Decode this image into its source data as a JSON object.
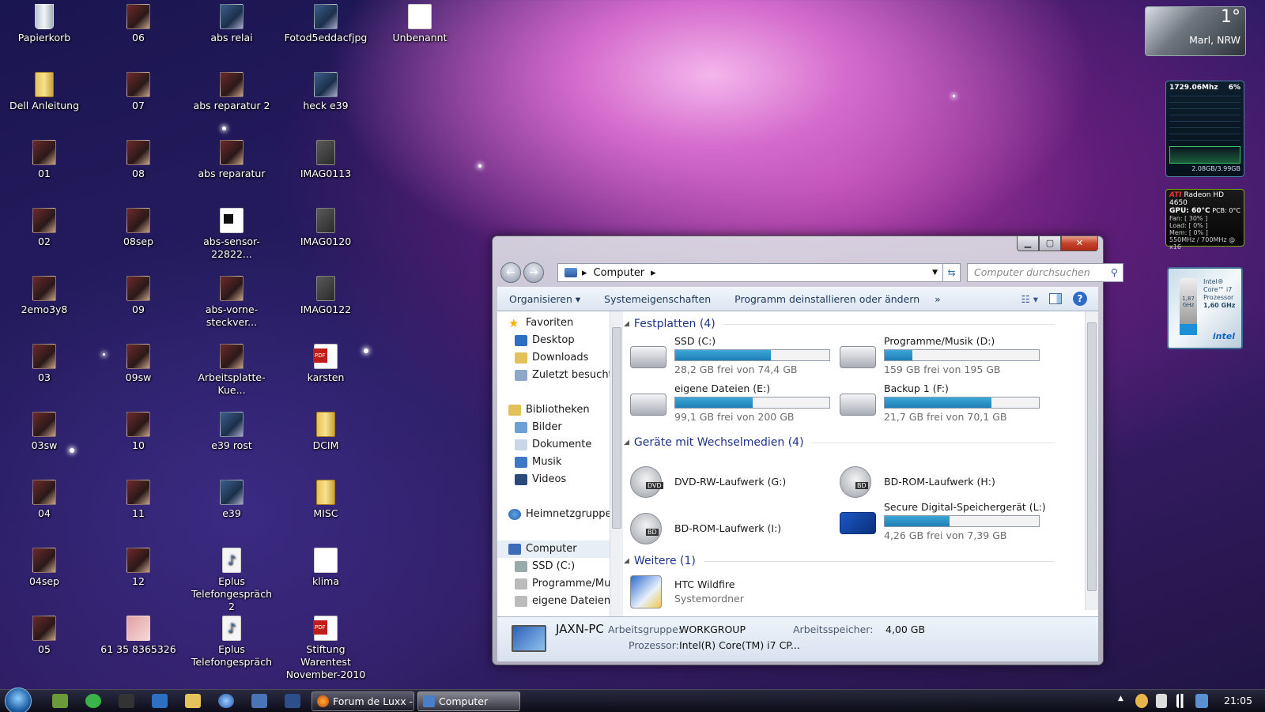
{
  "desktop": {
    "icons": [
      "Papierkorb",
      "06",
      "abs relai",
      "Fotod5eddacfjpg",
      "Unbenannt",
      "Dell Anleitung",
      "07",
      "abs reparatur 2",
      "heck e39",
      "01",
      "08",
      "abs reparatur",
      "IMAG0113",
      "02",
      "08sep",
      "abs-sensor-22822...",
      "IMAG0120",
      "2emo3y8",
      "09",
      "abs-vorne-steckver...",
      "IMAG0122",
      "03",
      "09sw",
      "Arbeitsplatte-Kue...",
      "karsten",
      "03sw",
      "10",
      "e39 rost",
      "DCIM",
      "04",
      "11",
      "e39",
      "MISC",
      "04sep",
      "12",
      "Eplus Telefongespräch 2",
      "klima",
      "05",
      "61 35 8365326",
      "Eplus Telefongespräch",
      "Stiftung Warentest November-2010"
    ]
  },
  "gadgets": {
    "weather": {
      "temp": "1°",
      "location": "Marl, NRW"
    },
    "cpu": {
      "freq": "1729.06Mhz",
      "usage": "6%",
      "mem": "2.08GB/3.99GB"
    },
    "gpu": {
      "brand": "ATI",
      "name": "Radeon HD 4650",
      "temp": "GPU: 60°C",
      "pcb": "PCB: 0°C",
      "fan": "Fan: [ 30% ]",
      "load": "Load: [ 0% ]",
      "memload": "Mem: [ 0% ]",
      "clock": "550MHz / 700MHz @ x16"
    },
    "intel": {
      "line1": "Intel®",
      "line2": "Core™ i7",
      "line3": "Prozessor",
      "freq": "1,60 GHz",
      "small": "1,87 GHz",
      "logo": "intel"
    }
  },
  "window": {
    "address": "Computer",
    "search_placeholder": "Computer durchsuchen",
    "commands": [
      "Organisieren ▾",
      "Systemeigenschaften",
      "Programm deinstallieren oder ändern",
      "»"
    ],
    "nav": [
      "Favoriten",
      "Desktop",
      "Downloads",
      "Zuletzt besucht",
      "Bibliotheken",
      "Bilder",
      "Dokumente",
      "Musik",
      "Videos",
      "Heimnetzgruppe",
      "Computer",
      "SSD (C:)",
      "Programme/Musi",
      "eigene Dateien (E"
    ],
    "groups": {
      "hdd": "Festplatten (4)",
      "removable": "Geräte mit Wechselmedien (4)",
      "other": "Weitere (1)"
    },
    "drives": [
      {
        "name": "SSD (C:)",
        "free": "28,2 GB frei von 74,4 GB",
        "used": 0.62
      },
      {
        "name": "Programme/Musik (D:)",
        "free": "159 GB frei von 195 GB",
        "used": 0.18
      },
      {
        "name": "eigene Dateien (E:)",
        "free": "99,1 GB frei von 200 GB",
        "used": 0.5
      },
      {
        "name": "Backup 1 (F:)",
        "free": "21,7 GB frei von 70,1 GB",
        "used": 0.69
      }
    ],
    "removable": [
      {
        "name": "DVD-RW-Laufwerk (G:)",
        "label": "DVD"
      },
      {
        "name": "BD-ROM-Laufwerk (H:)",
        "label": "BD"
      },
      {
        "name": "BD-ROM-Laufwerk (I:)",
        "label": "BD"
      },
      {
        "name": "Secure Digital-Speichergerät (L:)",
        "free": "4,26 GB frei von 7,39 GB",
        "used": 0.42
      }
    ],
    "other": {
      "name": "HTC Wildfire",
      "type": "Systemordner"
    },
    "details": {
      "pcname": "JAXN-PC",
      "wg_label": "Arbeitsgruppe:",
      "wg": "WORKGROUP",
      "mem_label": "Arbeitsspeicher:",
      "mem": "4,00 GB",
      "cpu_label": "Prozessor:",
      "cpu": "Intel(R) Core(TM) i7 CP..."
    }
  },
  "taskbar": {
    "buttons": [
      "Forum de Luxx -...",
      "Computer"
    ],
    "clock": "21:05"
  }
}
